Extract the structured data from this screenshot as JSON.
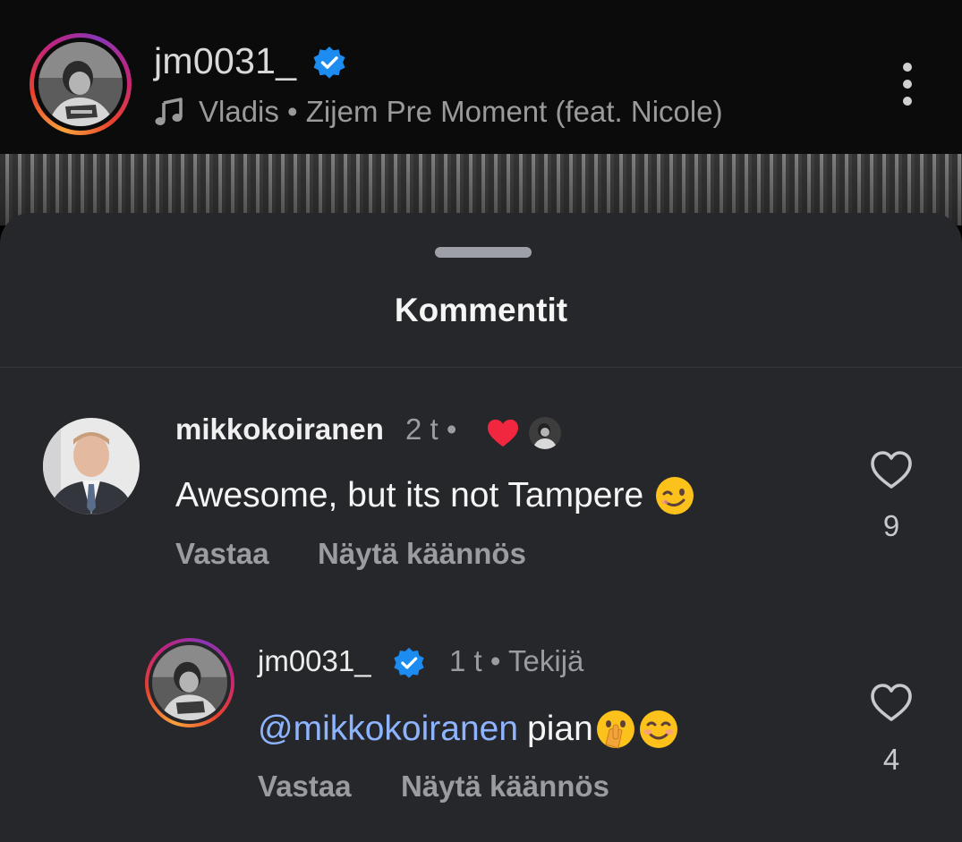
{
  "header": {
    "username": "jm0031_",
    "music": "Vladis • Zijem Pre Moment (feat. Nicole)",
    "icons": {
      "verified": "verified-badge-icon",
      "music": "music-note-icon",
      "more": "more-vertical-icon"
    }
  },
  "sheet": {
    "title": "Kommentit"
  },
  "comments": [
    {
      "username": "mikkokoiranen",
      "time": "2 t",
      "separator": "•",
      "liked_by_author": true,
      "text": "Awesome, but its not Tampere",
      "emojis": [
        "winking-face"
      ],
      "reply_label": "Vastaa",
      "translate_label": "Näytä käännös",
      "likes": "9"
    },
    {
      "username": "jm0031_",
      "verified": true,
      "time": "1 t",
      "separator": "•",
      "author_label": "Tekijä",
      "mention": "@mikkokoiranen",
      "text": "pian",
      "emojis": [
        "shushing-face",
        "smiling-face"
      ],
      "reply_label": "Vastaa",
      "translate_label": "Näytä käännös",
      "likes": "4"
    }
  ],
  "colors": {
    "background": "#25272b",
    "header": "#0b0b0b",
    "verified": "#1c8cf0",
    "heart_liked": "#f0273f",
    "mention": "#8fb4ff",
    "secondary_text": "#9a9ca1"
  }
}
